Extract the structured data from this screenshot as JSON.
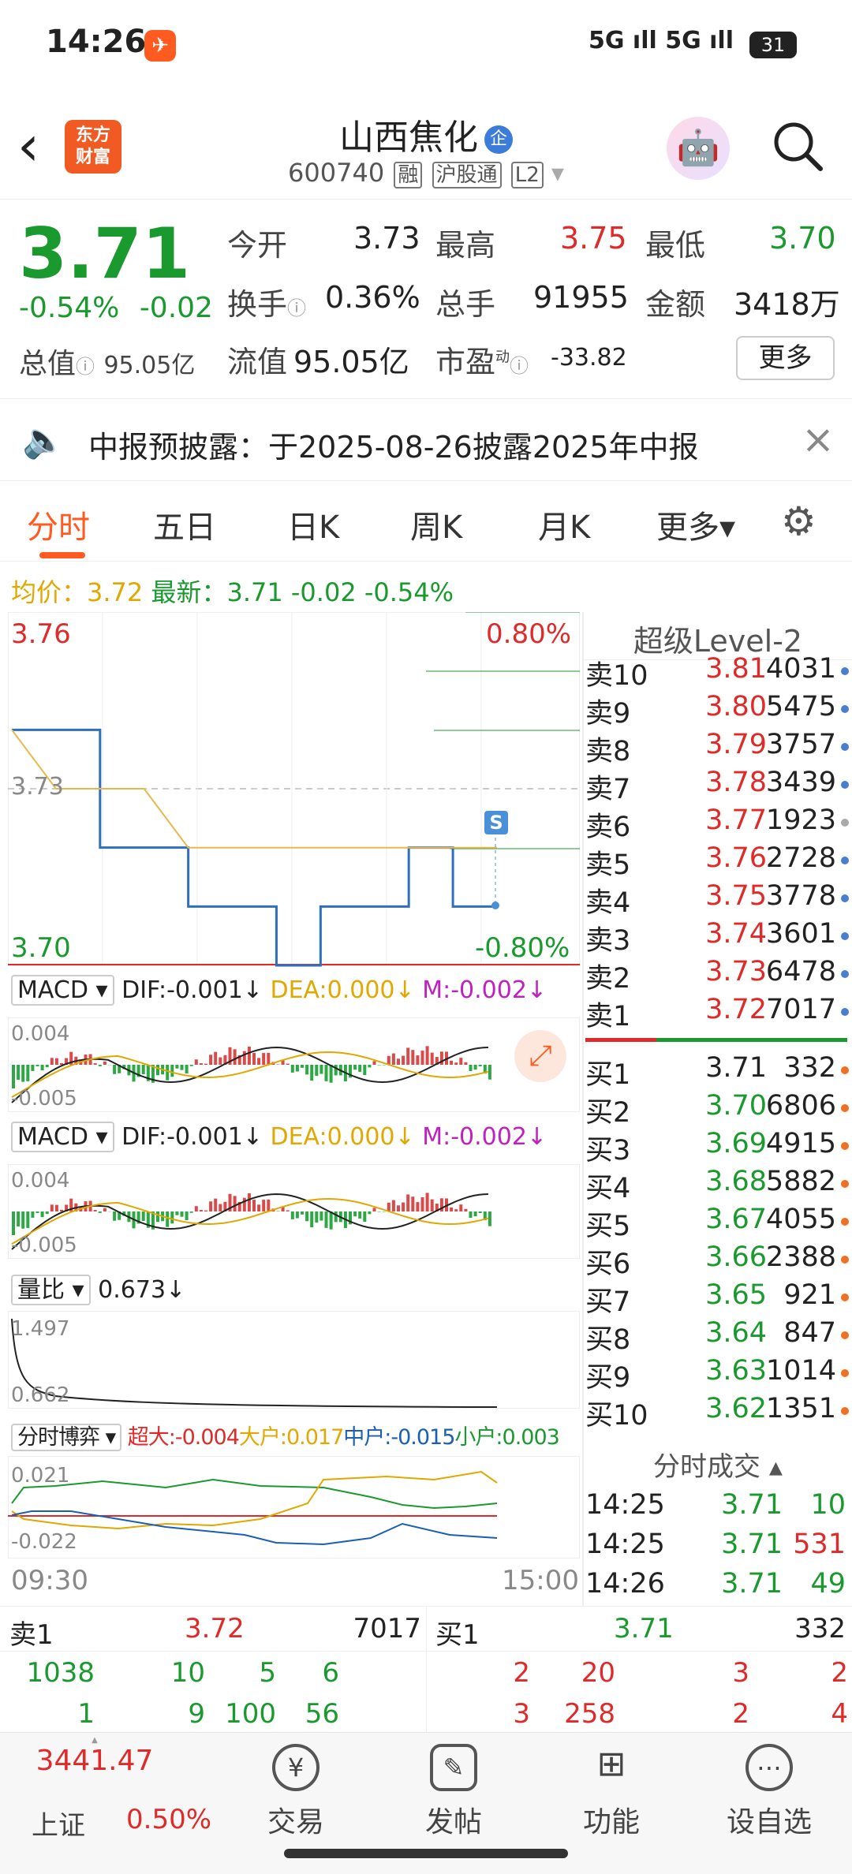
{
  "status": {
    "time": "14:26",
    "battery": "31",
    "signal": "5G ıll 5G ıll"
  },
  "nav": {
    "logo_line1": "东方",
    "logo_line2": "财富",
    "stock_name": "山西焦化",
    "badge": "企",
    "code": "600740",
    "tag1": "融",
    "tag2": "沪股通",
    "tag3": "L2"
  },
  "quote": {
    "price": "3.71",
    "pct": "-0.54%",
    "chg": "-0.02",
    "open_label": "今开",
    "open": "3.73",
    "high_label": "最高",
    "high": "3.75",
    "low_label": "最低",
    "low": "3.70",
    "turnover_label": "换手",
    "turnover": "0.36%",
    "vol_label": "总手",
    "vol": "91955",
    "amount_label": "金额",
    "amount": "3418万",
    "mktcap_label": "总值",
    "mktcap": "95.05亿",
    "float_label": "流值",
    "float": "95.05亿",
    "pe_label": "市盈",
    "pe_sup": "动",
    "pe": "-33.82",
    "more": "更多"
  },
  "notice": {
    "text": "中报预披露：于2025-08-26披露2025年中报"
  },
  "tabs": [
    "分时",
    "五日",
    "日K",
    "周K",
    "月K",
    "更多▾"
  ],
  "avg": {
    "avg_label": "均价：",
    "avg": "3.72",
    "latest_label": "最新：",
    "latest": "3.71",
    "chg": "-0.02",
    "pct": "-0.54%"
  },
  "chart": {
    "y_top": "3.76",
    "y_bottom": "3.70",
    "pct_top": "0.80%",
    "pct_bottom": "-0.80%",
    "y_mid": "3.73",
    "time_start": "09:30",
    "time_end": "15:00",
    "s_badge": "S",
    "macd1": {
      "name": "MACD",
      "dif": "DIF:-0.001↓",
      "dea": "DEA:0.000↓",
      "m": "M:-0.002↓",
      "top": "0.004",
      "bottom": "-0.005"
    },
    "macd2": {
      "name": "MACD",
      "dif": "DIF:-0.001↓",
      "dea": "DEA:0.000↓",
      "m": "M:-0.002↓",
      "top": "0.004",
      "bottom": "-0.005"
    },
    "vr": {
      "name": "量比",
      "value": "0.673↓",
      "top": "1.497",
      "bottom": "0.662"
    },
    "game": {
      "name": "分时博弈",
      "super": "超大:-0.004",
      "big": "大户:0.017",
      "mid": "中户:-0.015",
      "small": "小户:0.003",
      "top": "0.021",
      "bottom": "-0.022"
    }
  },
  "chart_data": {
    "type": "line",
    "title": "",
    "ylim": [
      3.7,
      3.76
    ],
    "x": [
      "09:30",
      "15:00"
    ],
    "series": [
      {
        "values": [
          3.74,
          3.74,
          3.72,
          3.72,
          3.71,
          3.71,
          3.7,
          3.71,
          3.71,
          3.72,
          3.71,
          3.71
        ]
      },
      {
        "values": [
          3.74,
          3.73,
          3.73,
          3.73,
          3.72,
          3.72,
          3.72,
          3.72,
          3.72,
          3.72,
          3.72,
          3.72
        ]
      }
    ]
  },
  "level2": {
    "title": "超级Level-2",
    "asks": [
      {
        "name": "卖10",
        "price": "3.81",
        "vol": "4031"
      },
      {
        "name": "卖9",
        "price": "3.80",
        "vol": "5475"
      },
      {
        "name": "卖8",
        "price": "3.79",
        "vol": "3757"
      },
      {
        "name": "卖7",
        "price": "3.78",
        "vol": "3439"
      },
      {
        "name": "卖6",
        "price": "3.77",
        "vol": "1923"
      },
      {
        "name": "卖5",
        "price": "3.76",
        "vol": "2728"
      },
      {
        "name": "卖4",
        "price": "3.75",
        "vol": "3778"
      },
      {
        "name": "卖3",
        "price": "3.74",
        "vol": "3601"
      },
      {
        "name": "卖2",
        "price": "3.73",
        "vol": "6478"
      },
      {
        "name": "卖1",
        "price": "3.72",
        "vol": "7017"
      }
    ],
    "bids": [
      {
        "name": "买1",
        "price": "3.71",
        "vol": "332"
      },
      {
        "name": "买2",
        "price": "3.70",
        "vol": "6806"
      },
      {
        "name": "买3",
        "price": "3.69",
        "vol": "4915"
      },
      {
        "name": "买4",
        "price": "3.68",
        "vol": "5882"
      },
      {
        "name": "买5",
        "price": "3.67",
        "vol": "4055"
      },
      {
        "name": "买6",
        "price": "3.66",
        "vol": "2388"
      },
      {
        "name": "买7",
        "price": "3.65",
        "vol": "921"
      },
      {
        "name": "买8",
        "price": "3.64",
        "vol": "847"
      },
      {
        "name": "买9",
        "price": "3.63",
        "vol": "1014"
      },
      {
        "name": "买10",
        "price": "3.62",
        "vol": "1351"
      }
    ],
    "ticks_title": "分时成交",
    "ticks": [
      {
        "time": "14:25",
        "price": "3.71",
        "vol": "10"
      },
      {
        "time": "14:25",
        "price": "3.71",
        "vol": "531"
      },
      {
        "time": "14:26",
        "price": "3.71",
        "vol": "49"
      }
    ]
  },
  "bottom_ob": {
    "sell_label": "卖1",
    "sell_price": "3.72",
    "sell_vol": "7017",
    "buy_label": "买1",
    "buy_price": "3.71",
    "buy_vol": "332",
    "sell_row1": [
      "1038",
      "10",
      "5",
      "6"
    ],
    "sell_row2": [
      "1",
      "9",
      "100",
      "56"
    ],
    "buy_row1": [
      "2",
      "20",
      "3",
      "2"
    ],
    "buy_row2": [
      "3",
      "258",
      "2",
      "4"
    ]
  },
  "bottombar": {
    "index_value": "3441.47",
    "index_name": "上证",
    "index_pct": "0.50%",
    "trade": "交易",
    "post": "发帖",
    "func": "功能",
    "watch": "设自选"
  }
}
